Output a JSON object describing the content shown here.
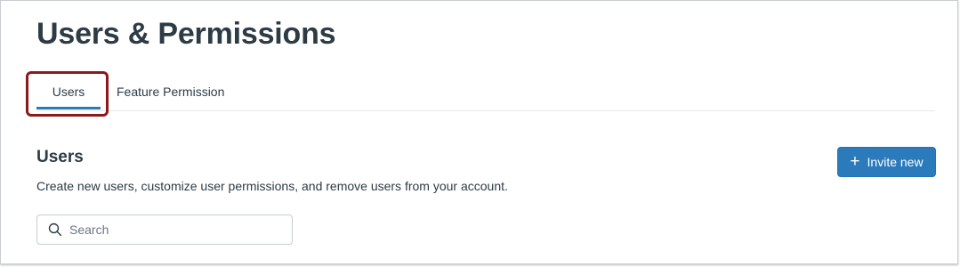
{
  "page": {
    "title": "Users & Permissions"
  },
  "tabs": [
    {
      "label": "Users",
      "selected": true
    },
    {
      "label": "Feature Permission",
      "selected": false
    }
  ],
  "section": {
    "heading": "Users",
    "description": "Create new users, customize user permissions, and remove users from your account."
  },
  "invite_button": {
    "label": "Invite new",
    "icon": "plus-icon"
  },
  "search": {
    "placeholder": "Search",
    "value": "",
    "icon": "search-icon"
  },
  "colors": {
    "primary": "#2b7abc",
    "text": "#2d3b45",
    "highlight": "#8b1a1a"
  }
}
